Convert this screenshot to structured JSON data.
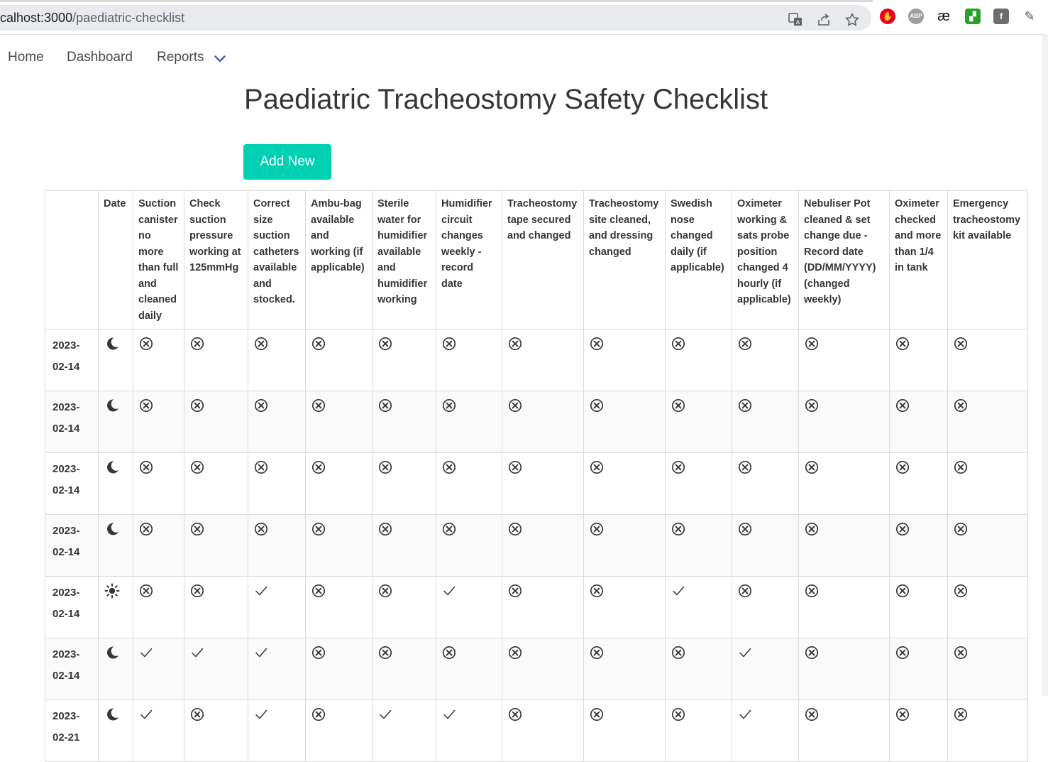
{
  "browser": {
    "url_host": "calhost:3000",
    "url_path": "/paediatric-checklist"
  },
  "nav": {
    "home": "Home",
    "dashboard": "Dashboard",
    "reports": "Reports"
  },
  "page": {
    "title": "Paediatric Tracheostomy Safety Checklist",
    "add_button": "Add New"
  },
  "table": {
    "headers": [
      "",
      "Date",
      "Suction canister no more than full and cleaned daily",
      "Check suction pressure working at 125mmHg",
      "Correct size suction catheters available and stocked.",
      "Ambu-bag available and working (if applicable)",
      "Sterile water for humidifier available and humidifier working",
      "Humidifier circuit changes weekly - record date",
      "Tracheostomy tape secured and changed",
      "Tracheostomy site cleaned, and dressing changed",
      "Swedish nose changed daily (if applicable)",
      "Oximeter working & sats probe position changed 4 hourly (if applicable)",
      "Nebuliser Pot cleaned & set change due - Record date (DD/MM/YYYY) (changed weekly)",
      "Oximeter checked and more than 1/4 in tank",
      "Emergency tracheostomy kit available"
    ],
    "rows": [
      {
        "date": "2023-02-14",
        "period": "moon",
        "checks": [
          false,
          false,
          false,
          false,
          false,
          false,
          false,
          false,
          false,
          false,
          false,
          false,
          false
        ]
      },
      {
        "date": "2023-02-14",
        "period": "moon",
        "checks": [
          false,
          false,
          false,
          false,
          false,
          false,
          false,
          false,
          false,
          false,
          false,
          false,
          false
        ]
      },
      {
        "date": "2023-02-14",
        "period": "moon",
        "checks": [
          false,
          false,
          false,
          false,
          false,
          false,
          false,
          false,
          false,
          false,
          false,
          false,
          false
        ]
      },
      {
        "date": "2023-02-14",
        "period": "moon",
        "checks": [
          false,
          false,
          false,
          false,
          false,
          false,
          false,
          false,
          false,
          false,
          false,
          false,
          false
        ]
      },
      {
        "date": "2023-02-14",
        "period": "sun",
        "checks": [
          false,
          false,
          true,
          false,
          false,
          true,
          false,
          false,
          true,
          false,
          false,
          false,
          false
        ]
      },
      {
        "date": "2023-02-14",
        "period": "moon",
        "checks": [
          true,
          true,
          true,
          false,
          false,
          false,
          false,
          false,
          false,
          true,
          false,
          false,
          false
        ]
      },
      {
        "date": "2023-02-21",
        "period": "moon",
        "checks": [
          true,
          false,
          true,
          false,
          true,
          true,
          false,
          false,
          false,
          true,
          false,
          false,
          false
        ]
      }
    ]
  }
}
